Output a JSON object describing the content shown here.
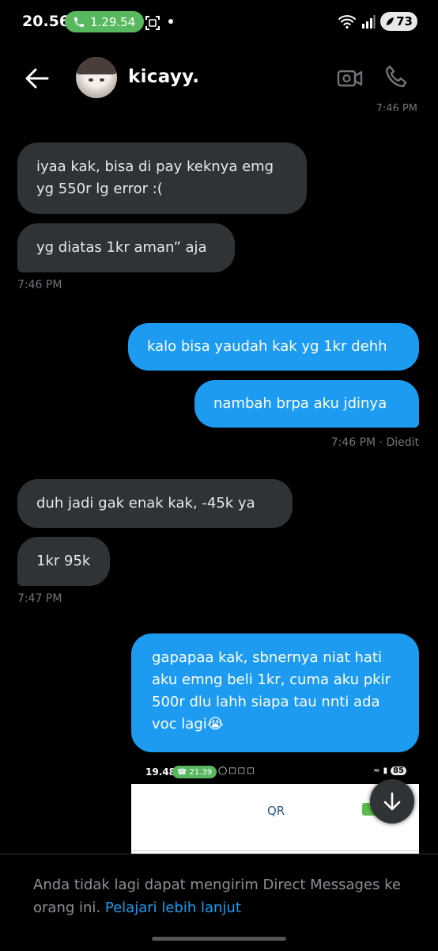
{
  "status_bar": {
    "time": "20.56",
    "call_timer": "1.29.54",
    "battery": "73"
  },
  "header": {
    "contact_name": "kicayy."
  },
  "clipped_timestamp": "7:46 PM",
  "messages": [
    {
      "lines": [
        "iyaa kak, bisa di pay keknya emg",
        "yg 550r lg error :("
      ]
    },
    {
      "lines": [
        "yg diatas 1kr aman” aja"
      ]
    },
    {
      "stamp": "7:46 PM"
    },
    {
      "lines": [
        "kalo bisa yaudah kak yg 1kr dehh"
      ]
    },
    {
      "lines": [
        "nambah brpa aku jdinya"
      ]
    },
    {
      "stamp": "7:46 PM · Diedit"
    },
    {
      "lines": [
        "duh jadi gak enak kak, -45k ya"
      ]
    },
    {
      "lines": [
        "1kr 95k"
      ]
    },
    {
      "stamp": "7:47 PM"
    },
    {
      "lines": [
        "gapapaa kak, sbnernya niat hati",
        "aku emng beli 1kr, cuma aku pkir",
        "500r dlu lahh siapa tau nnti ada",
        "voc lagi😭"
      ]
    }
  ],
  "attachment": {
    "time": "19.48",
    "call_timer": "21.39",
    "battery": "85",
    "label": "QR"
  },
  "footer": {
    "text": "Anda tidak lagi dapat mengirim Direct Messages ke orang ini.",
    "link": "Pelajari lebih lanjut"
  },
  "colors": {
    "background": "#000000",
    "incoming_bubble": "#2f3336",
    "outgoing_bubble": "#1d9bf0",
    "call_pill": "#58b85f",
    "muted_text": "#71767b"
  }
}
